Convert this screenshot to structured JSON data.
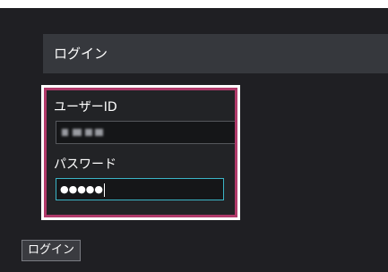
{
  "header": {
    "title": "ログイン"
  },
  "form": {
    "userid_label": "ユーザーID",
    "userid_value": "",
    "password_label": "パスワード",
    "password_value": "●●●●●"
  },
  "actions": {
    "login_label": "ログイン"
  },
  "colors": {
    "highlight": "#b03a6a",
    "focus_border": "#3bb4c6",
    "background": "#1f1f23"
  }
}
